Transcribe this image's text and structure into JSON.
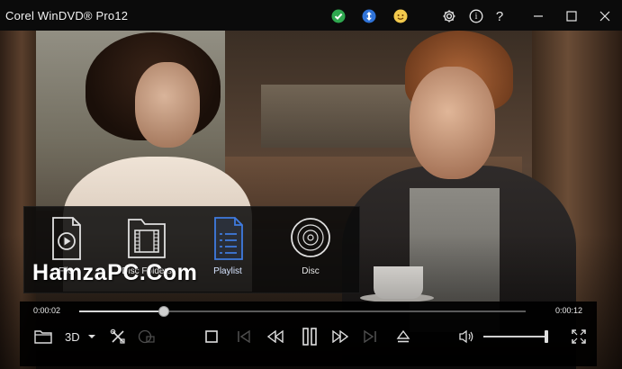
{
  "window": {
    "title": "Corel WinDVD® Pro12",
    "status_icons": [
      "check-status-icon",
      "up-down-arrows-icon",
      "smiley-icon"
    ],
    "buttons": [
      "gear-icon",
      "info-icon",
      "help-icon",
      "minimize-icon",
      "maximize-icon",
      "close-icon"
    ],
    "help_glyph": "?",
    "info_glyph": "i"
  },
  "media_menu": {
    "items": [
      {
        "label": "File",
        "icon": "file-play-icon"
      },
      {
        "label": "Disc Folders",
        "icon": "film-folder-icon"
      },
      {
        "label": "Playlist",
        "icon": "playlist-icon"
      },
      {
        "label": "Disc",
        "icon": "disc-icon"
      }
    ],
    "selected_index": 2
  },
  "watermark": "HamzaPC.Com",
  "playback": {
    "current_time": "0:00:02",
    "total_time": "0:00:12",
    "progress": 0.19,
    "volume": 1.0
  },
  "controls": {
    "three_d_label": "3D",
    "buttons": [
      "open-folder-icon",
      "3d-mode-button",
      "tools-icon",
      "subtitle-icon",
      "stop-icon",
      "previous-icon",
      "rewind-icon",
      "pause-icon",
      "fast-forward-icon",
      "next-icon",
      "eject-icon",
      "volume-icon",
      "fullscreen-icon"
    ]
  },
  "colors": {
    "selected_item": "#3f7be0",
    "accent_green": "#2fa84f",
    "accent_blue": "#2f73d8",
    "accent_yellow": "#f2c94c"
  }
}
